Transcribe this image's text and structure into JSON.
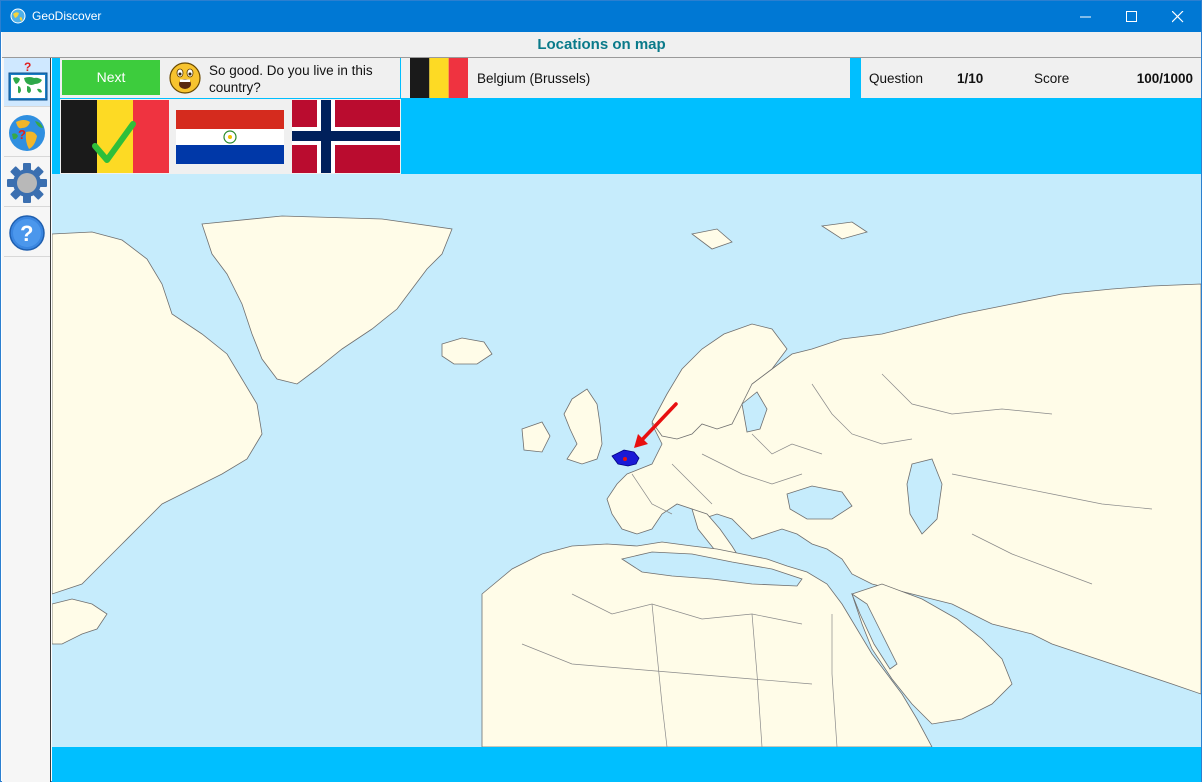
{
  "window": {
    "title": "GeoDiscover"
  },
  "header": {
    "title": "Locations on map"
  },
  "sidebar": {
    "items": [
      {
        "name": "map-quiz",
        "icon": "world-map-question-icon",
        "active": true
      },
      {
        "name": "globe-quiz",
        "icon": "globe-question-icon",
        "active": false
      },
      {
        "name": "settings",
        "icon": "gear-icon",
        "active": false
      },
      {
        "name": "help",
        "icon": "help-icon",
        "active": false
      }
    ]
  },
  "quiz": {
    "next_label": "Next",
    "feedback": "So good. Do you live in this country?",
    "answer": "Belgium (Brussels)",
    "answer_flag": "flag-belgium",
    "options": [
      {
        "flag": "flag-belgium",
        "correct": true
      },
      {
        "flag": "flag-paraguay",
        "correct": false
      },
      {
        "flag": "flag-norway",
        "correct": false
      }
    ]
  },
  "status": {
    "question_label": "Question",
    "question_value": "1/10",
    "score_label": "Score",
    "score_value": "100/1000"
  },
  "colors": {
    "title_bar": "#0078d4",
    "header_text": "#0a7a8a",
    "next_button": "#3dcc3d",
    "content_bg": "#00bfff",
    "sea": "#c6ecfc",
    "land": "#fffce8",
    "highlight_country": "#1a1ad6",
    "arrow": "#e81010"
  }
}
